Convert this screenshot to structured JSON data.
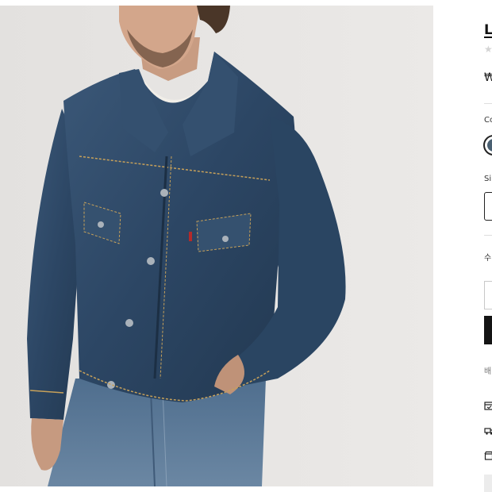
{
  "product": {
    "title": "L",
    "rating_stars": "★",
    "price": "₩"
  },
  "options": {
    "color_label": "Co",
    "selected_color": "#4a6072",
    "size_label": "Si",
    "quantity_label": "수"
  },
  "shipping": {
    "label": "배"
  },
  "icons": [
    "calendar-icon",
    "truck-icon",
    "store-icon"
  ],
  "colors": {
    "photo_background": "#e6e4e2",
    "denim": "#2e4a66",
    "cta": "#141414"
  }
}
